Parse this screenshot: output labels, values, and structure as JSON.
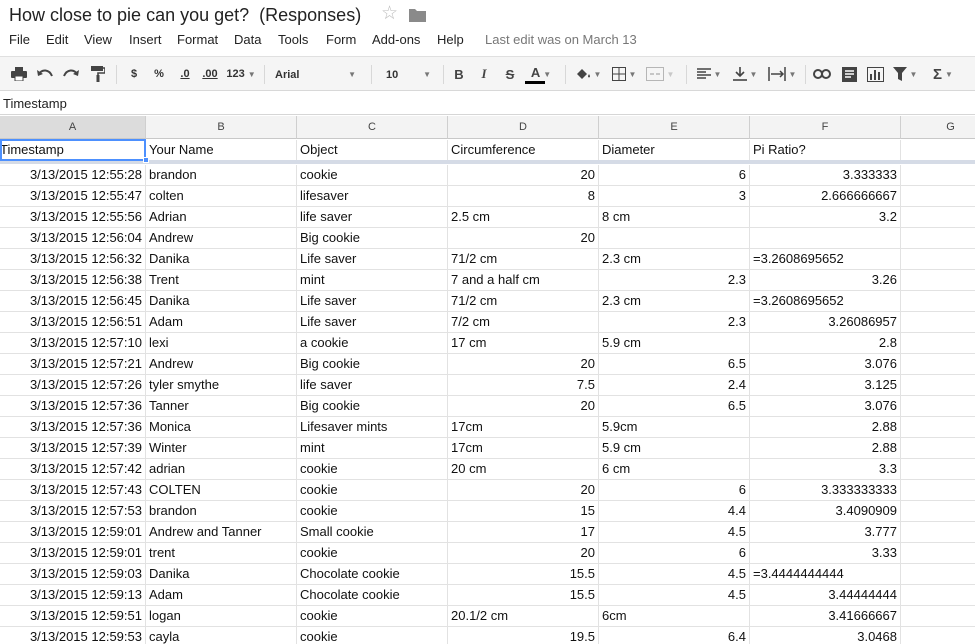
{
  "doc": {
    "title": "How close to pie can you get?  (Responses)",
    "last_edit": "Last edit was on March 13"
  },
  "menu": [
    "File",
    "Edit",
    "View",
    "Insert",
    "Format",
    "Data",
    "Tools",
    "Form",
    "Add-ons",
    "Help"
  ],
  "toolbar": {
    "currency": "$",
    "percent": "%",
    "dec_decrease": ".0",
    "dec_increase": ".00",
    "more_formats": "123",
    "font": "Arial",
    "font_size": "10",
    "bold": "B",
    "italic": "I",
    "strike": "S",
    "text_color": "A",
    "text_color_value": "#000000",
    "functions": "Σ"
  },
  "formula_bar": {
    "text": "Timestamp"
  },
  "columns": [
    "A",
    "B",
    "C",
    "D",
    "E",
    "F",
    "G"
  ],
  "header_row": [
    "Timestamp",
    "Your Name",
    "Object",
    "Circumference",
    "Diameter",
    "Pi Ratio?"
  ],
  "rows": [
    [
      "3/13/2015 12:55:28",
      "brandon",
      "cookie",
      "20",
      "6",
      "3.333333"
    ],
    [
      "3/13/2015 12:55:47",
      "colten",
      "lifesaver",
      "8",
      "3",
      "2.666666667"
    ],
    [
      "3/13/2015 12:55:56",
      "Adrian",
      "life saver",
      "2.5 cm",
      "8 cm",
      "3.2"
    ],
    [
      "3/13/2015 12:56:04",
      "Andrew",
      "Big cookie",
      "20",
      "",
      ""
    ],
    [
      "3/13/2015 12:56:32",
      "Danika",
      "Life saver",
      "71/2 cm",
      "2.3 cm",
      "=3.2608695652"
    ],
    [
      "3/13/2015 12:56:38",
      "Trent",
      "mint",
      "7 and a half cm",
      "2.3",
      "3.26"
    ],
    [
      "3/13/2015 12:56:45",
      "Danika",
      "Life saver",
      "71/2 cm",
      "2.3 cm",
      "=3.2608695652"
    ],
    [
      "3/13/2015 12:56:51",
      "Adam",
      "Life saver",
      "7/2 cm",
      "2.3",
      "3.26086957"
    ],
    [
      "3/13/2015 12:57:10",
      "lexi",
      "a cookie",
      "17 cm",
      "5.9 cm",
      "2.8"
    ],
    [
      "3/13/2015 12:57:21",
      "Andrew",
      "Big cookie",
      "20",
      "6.5",
      "3.076"
    ],
    [
      "3/13/2015 12:57:26",
      "tyler smythe",
      "life saver",
      "7.5",
      "2.4",
      "3.125"
    ],
    [
      "3/13/2015 12:57:36",
      "Tanner",
      "Big cookie",
      "20",
      "6.5",
      "3.076"
    ],
    [
      "3/13/2015 12:57:36",
      "Monica",
      "Lifesaver mints",
      "17cm",
      "5.9cm",
      "2.88"
    ],
    [
      "3/13/2015 12:57:39",
      "Winter",
      "mint",
      "17cm",
      "5.9 cm",
      "2.88"
    ],
    [
      "3/13/2015 12:57:42",
      "adrian",
      "cookie",
      "20 cm",
      "6 cm",
      "3.3"
    ],
    [
      "3/13/2015 12:57:43",
      "COLTEN",
      "cookie",
      "20",
      "6",
      "3.333333333"
    ],
    [
      "3/13/2015 12:57:53",
      "brandon",
      "cookie",
      "15",
      "4.4",
      "3.4090909"
    ],
    [
      "3/13/2015 12:59:01",
      "Andrew and Tanner",
      "Small cookie",
      "17",
      "4.5",
      "3.777"
    ],
    [
      "3/13/2015 12:59:01",
      "trent",
      "cookie",
      "20",
      "6",
      "3.33"
    ],
    [
      "3/13/2015 12:59:03",
      "Danika",
      "Chocolate cookie",
      "15.5",
      "4.5",
      "=3.4444444444"
    ],
    [
      "3/13/2015 12:59:13",
      "Adam",
      "Chocolate cookie",
      "15.5",
      "4.5",
      "3.44444444"
    ],
    [
      "3/13/2015 12:59:51",
      "logan",
      "cookie",
      "20.1/2 cm",
      "6cm",
      "3.41666667"
    ],
    [
      "3/13/2015 12:59:53",
      "cayla",
      "cookie",
      "19.5",
      "6.4",
      "3.0468"
    ]
  ]
}
